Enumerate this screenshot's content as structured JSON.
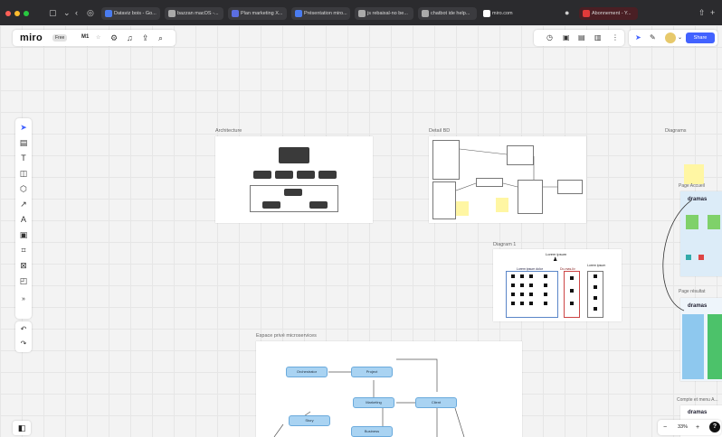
{
  "browser": {
    "tabs": [
      {
        "title": "Dataviz bois - Go..."
      },
      {
        "title": "bazzan macOS -..."
      },
      {
        "title": "Plan marketing X..."
      },
      {
        "title": "Présentation miro..."
      },
      {
        "title": "js rebaixal-no be..."
      },
      {
        "title": "chatbot ide help..."
      },
      {
        "title": "miro.com"
      },
      {
        "title": "Abonnement - Y..."
      }
    ]
  },
  "toolbar": {
    "logo": "miro",
    "plan": "Free",
    "board_name": "M1",
    "share_label": "Share"
  },
  "frames": [
    {
      "title": "Architecture"
    },
    {
      "title": "Detail BD"
    },
    {
      "title": "Diagrams"
    },
    {
      "title": "Diagram 1"
    },
    {
      "title": "Espace privé microservices"
    }
  ],
  "diagram": {
    "org_top": "Lorem ipsum",
    "col_a": "Lorem ipsum dolor",
    "col_b": "Do-mas-liv",
    "col_c": "Lorem ipsum"
  },
  "micro": {
    "nodes": [
      "Orchestrator",
      "Project",
      "Marketing",
      "Client",
      "Story",
      "Business"
    ]
  },
  "diagrams_side": {
    "page_label_1": "Page Accueil",
    "page_label_2": "Page résultat",
    "page_label_3": "Compte et menu A...",
    "brand": "dramas"
  },
  "zoom": {
    "minus": "−",
    "value": "33%",
    "plus": "+"
  },
  "help": "?"
}
